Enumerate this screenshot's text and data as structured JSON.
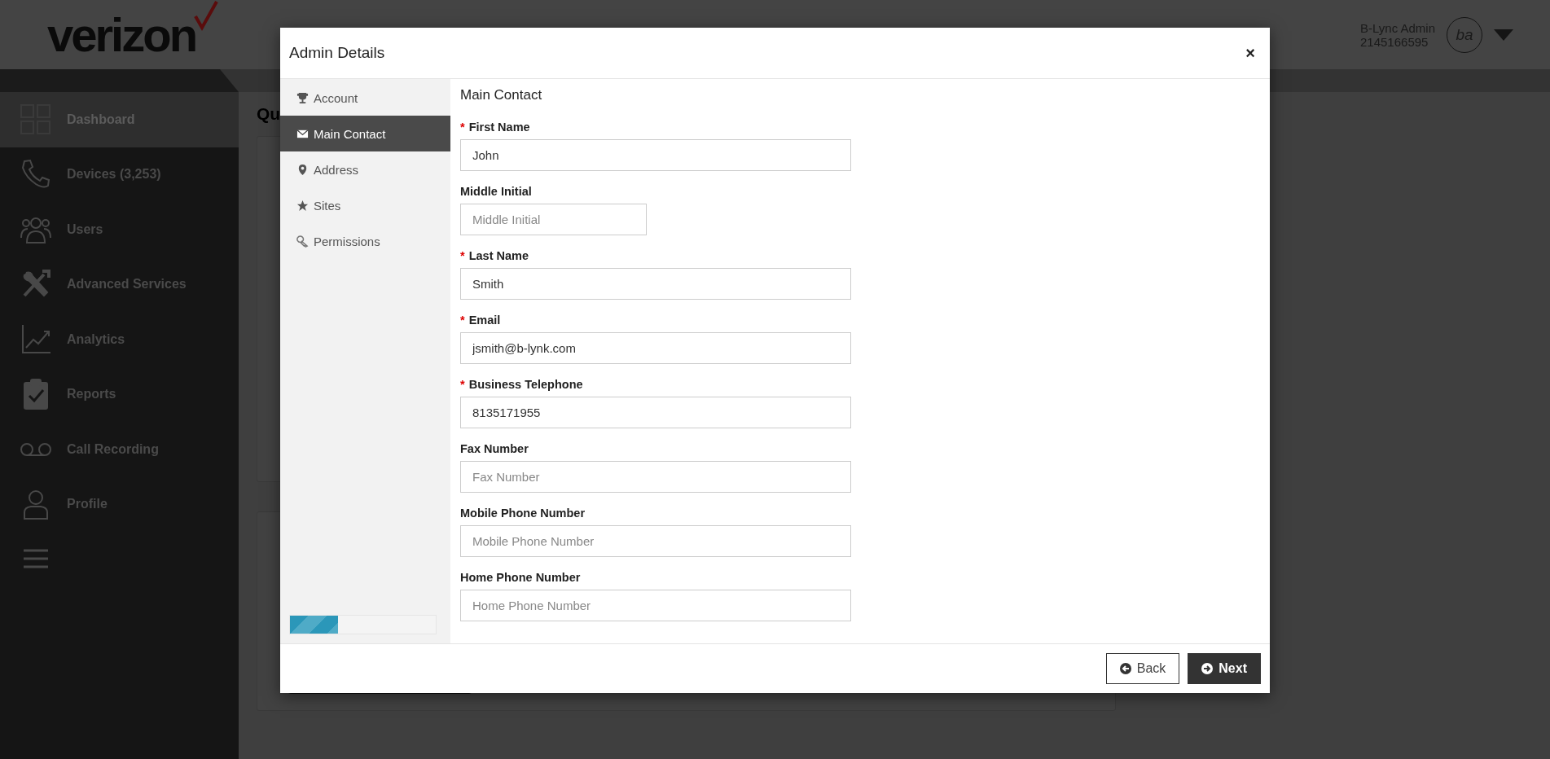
{
  "header": {
    "logo": "verizon",
    "user_name": "B-Lync Admin",
    "user_phone": "2145166595",
    "avatar_initials": "ba"
  },
  "sidebar": {
    "items": [
      {
        "label": "Dashboard",
        "selected": true
      },
      {
        "label": "Devices (3,253)",
        "selected": false
      },
      {
        "label": "Users",
        "selected": false
      },
      {
        "label": "Advanced Services",
        "selected": false
      },
      {
        "label": "Analytics",
        "selected": false
      },
      {
        "label": "Reports",
        "selected": false
      },
      {
        "label": "Call Recording",
        "selected": false
      },
      {
        "label": "Profile",
        "selected": false
      }
    ]
  },
  "page": {
    "heading": "Qu"
  },
  "modal": {
    "title": "Admin Details",
    "close": "×",
    "nav": [
      {
        "label": "Account",
        "selected": false
      },
      {
        "label": "Main Contact",
        "selected": true
      },
      {
        "label": "Address",
        "selected": false
      },
      {
        "label": "Sites",
        "selected": false
      },
      {
        "label": "Permissions",
        "selected": false
      }
    ],
    "progress": {
      "level": 0.33
    },
    "section_title": "Main Contact",
    "fields": [
      {
        "label": "First Name",
        "marker": "*",
        "value": "John",
        "kind": "wide"
      },
      {
        "label": "Middle Initial",
        "placeholder": "Middle Initial",
        "kind": "narrow"
      },
      {
        "label": "Last Name",
        "marker": "*",
        "value": "Smith",
        "kind": "wide"
      },
      {
        "label": "Email",
        "marker": "*",
        "value": "jsmith@b-lynk.com",
        "kind": "wide"
      },
      {
        "label": "Business Telephone",
        "marker": "*",
        "value": "8135171955",
        "kind": "wide"
      },
      {
        "label": "Fax Number",
        "placeholder": "Fax Number",
        "kind": "wide"
      },
      {
        "label": "Mobile Phone Number",
        "placeholder": "Mobile Phone Number",
        "kind": "wide"
      },
      {
        "label": "Home Phone Number",
        "placeholder": "Home Phone Number",
        "kind": "wide"
      }
    ],
    "buttons": [
      {
        "label": "Back",
        "kind": "secondary"
      },
      {
        "label": "Next",
        "kind": "primary"
      }
    ]
  }
}
